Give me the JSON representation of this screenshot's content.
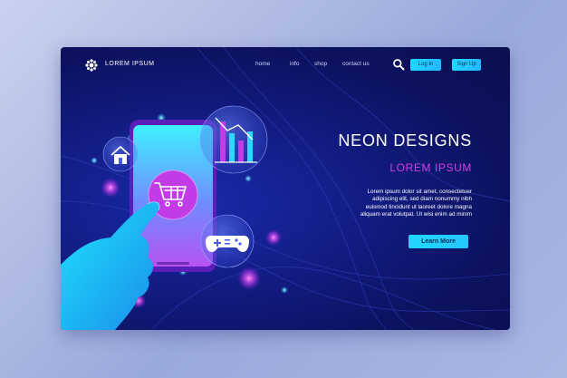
{
  "brand": {
    "name": "LOREM IPSUM"
  },
  "nav": {
    "items": [
      {
        "label": "home"
      },
      {
        "label": "info"
      },
      {
        "label": "shop"
      },
      {
        "label": "contact us"
      }
    ],
    "login_label": "Log In",
    "signup_label": "Sign Up"
  },
  "hero": {
    "title": "NEON DESIGNS",
    "subtitle": "LOREM IPSUM",
    "body_lines": [
      "Lorem ipsum dolor sit amet, consectetuer",
      "adipiscing elit, sed diam nonummy nibh",
      "euismod tincidunt ut laoreet dolore magna",
      "aliquam erat volutpat. Ut wisi enim ad minim"
    ],
    "cta_label": "Learn More"
  },
  "icons": [
    "logo-icon",
    "search-icon",
    "house-icon",
    "bar-chart-icon",
    "shopping-cart-icon",
    "gamepad-icon",
    "smartphone-icon",
    "hand-icon"
  ],
  "colors": {
    "accent": "#1fd8ff",
    "magenta": "#d33ee2",
    "background": "#131d86"
  }
}
